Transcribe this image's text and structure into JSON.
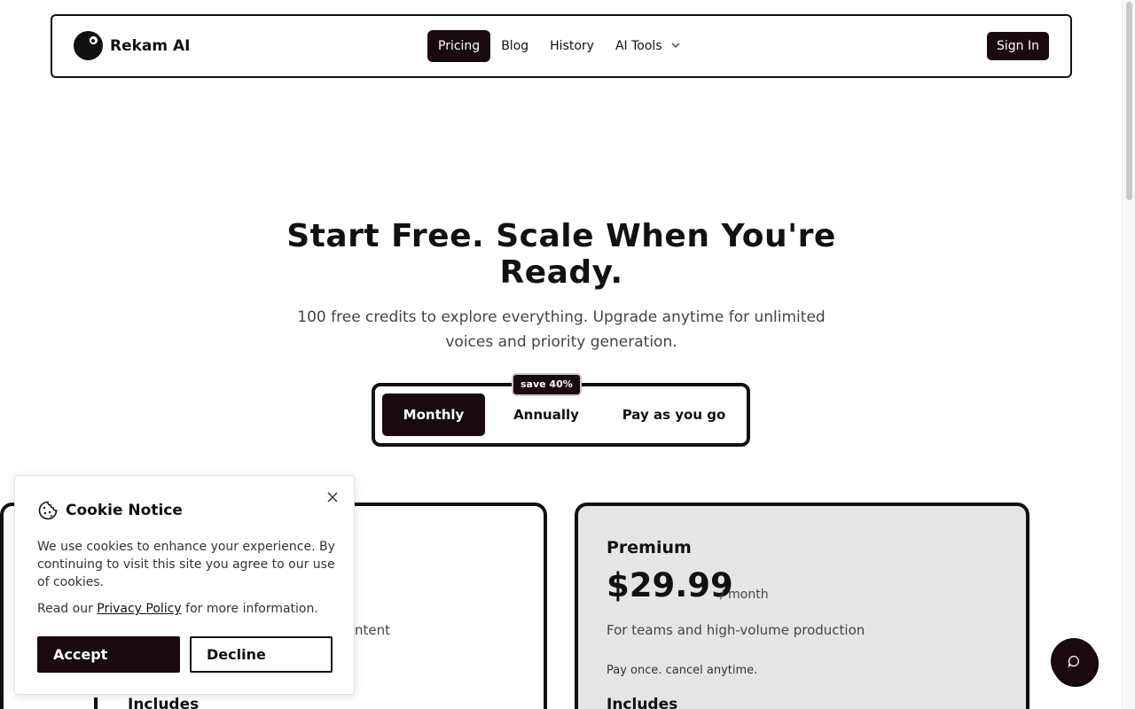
{
  "navbar": {
    "brand": "Rekam AI",
    "links": [
      {
        "label": "Pricing",
        "active": true
      },
      {
        "label": "Blog",
        "active": false
      },
      {
        "label": "History",
        "active": false
      },
      {
        "label": "AI Tools",
        "active": false
      }
    ],
    "sign_in": "Sign In"
  },
  "hero": {
    "title": "Start Free. Scale When You're Ready.",
    "subtitle": "100 free credits to explore everything. Upgrade anytime for unlimited voices and priority generation."
  },
  "billing_toggle": {
    "options": [
      "Monthly",
      "Annually",
      "Pay as you go"
    ],
    "selected": "Monthly",
    "badge": "save 40%"
  },
  "plans": {
    "basic": {
      "description_fragment": "ntent",
      "includes": "Includes"
    },
    "premium": {
      "name": "Premium",
      "price": "$29.99",
      "period": "/ month",
      "description": "For teams and high-volume production",
      "note": "Pay once. cancel anytime.",
      "includes": "Includes"
    }
  },
  "cookie_notice": {
    "title": "Cookie Notice",
    "text": "We use cookies to enhance your experience. By continuing to visit this site you agree to our use of cookies.",
    "read_prefix": "Read our",
    "policy_link": "Privacy Policy",
    "read_suffix": "for more information.",
    "accept": "Accept",
    "decline": "Decline"
  },
  "colors": {
    "accent": "#1a0a10",
    "premium_bg": "#e5e5e5"
  }
}
